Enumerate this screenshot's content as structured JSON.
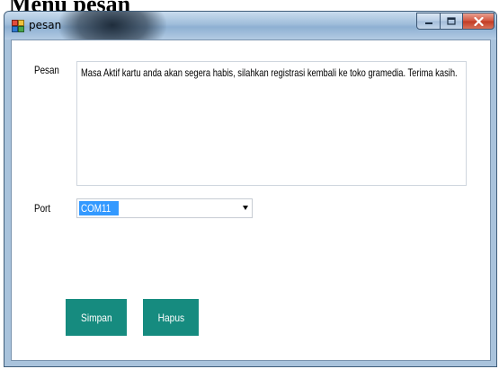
{
  "document": {
    "heading": "Menu pesan"
  },
  "window": {
    "title": "pesan"
  },
  "form": {
    "pesan_label": "Pesan",
    "pesan_value": "Masa Aktif kartu anda akan segera habis, silahkan registrasi kembali ke toko gramedia. Terima kasih.",
    "port_label": "Port",
    "port_value": "COM11",
    "simpan_label": "Simpan",
    "hapus_label": "Hapus"
  },
  "icons": {
    "app": "application-form-icon",
    "minimize": "minimize-icon",
    "maximize": "maximize-icon",
    "close": "close-icon",
    "dropdown": "chevron-down-icon"
  },
  "colors": {
    "button": "#168b7f",
    "selection": "#3399ff",
    "close": "#c23a22"
  }
}
